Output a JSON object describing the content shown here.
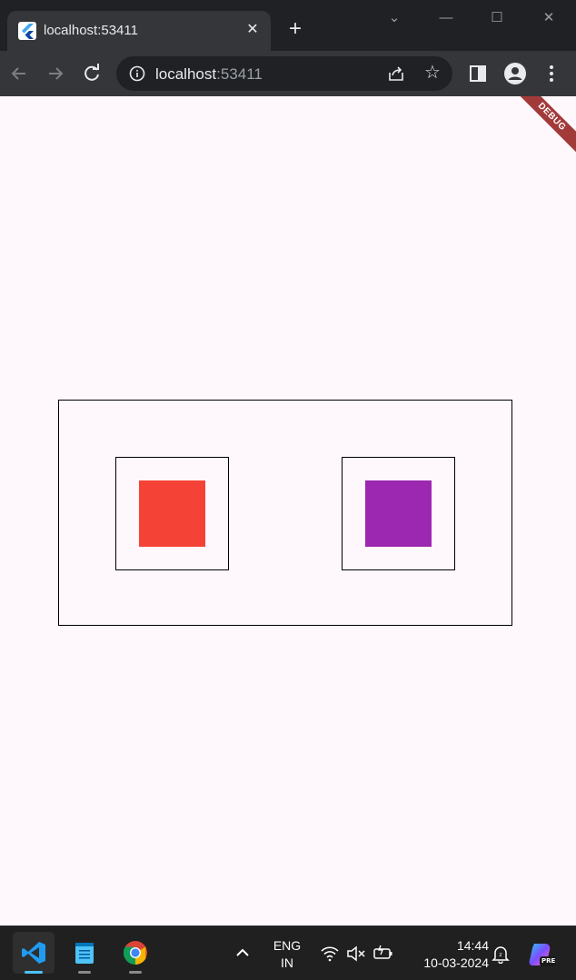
{
  "browser": {
    "tab": {
      "title": "localhost:53411",
      "close_label": "✕"
    },
    "new_tab_label": "+",
    "window_controls": {
      "chevron": "⌄",
      "minimize": "—",
      "maximize": "☐",
      "close": "✕"
    },
    "omnibox": {
      "host": "localhost",
      "port": ":53411"
    },
    "icons": [
      "back-icon",
      "forward-icon",
      "reload-icon",
      "info-icon",
      "share-icon",
      "star-icon",
      "side-panel-icon",
      "profile-icon",
      "menu-icon"
    ]
  },
  "app": {
    "debug_banner": "DEBUG",
    "colors": {
      "background": "#fef7fb",
      "left_square": "#f44336",
      "right_square": "#9c27b0",
      "border": "#000000",
      "banner": "#a33a3a"
    }
  },
  "taskbar": {
    "apps": [
      {
        "name": "vscode-icon",
        "active": true
      },
      {
        "name": "notepad-icon",
        "active": false
      },
      {
        "name": "chrome-icon",
        "active": false
      }
    ],
    "language": {
      "line1": "ENG",
      "line2": "IN"
    },
    "clock": {
      "time": "14:44",
      "date": "10-03-2024"
    },
    "tray_icons": [
      "chevron-up-icon",
      "wifi-icon",
      "mute-icon",
      "battery-icon",
      "notification-icon",
      "copilot-icon"
    ],
    "copilot_badge": "PRE"
  }
}
